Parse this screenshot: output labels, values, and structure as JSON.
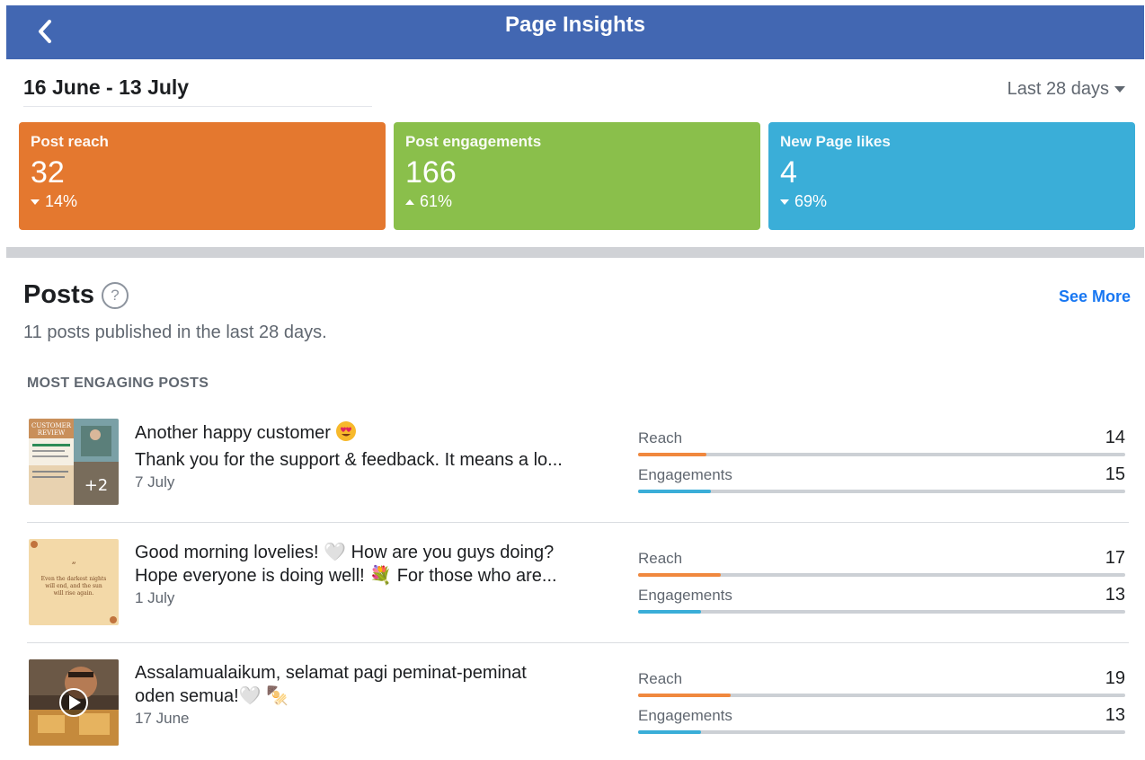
{
  "header": {
    "title": "Page Insights",
    "back_icon": "chevron-left-icon"
  },
  "range": {
    "date_range": "16 June - 13 July",
    "period": "Last 28 days"
  },
  "cards": [
    {
      "label": "Post reach",
      "value": "32",
      "change": "14%",
      "direction": "down",
      "color": "#e4782f"
    },
    {
      "label": "Post engagements",
      "value": "166",
      "change": "61%",
      "direction": "up",
      "color": "#8abf4b"
    },
    {
      "label": "New Page likes",
      "value": "4",
      "change": "69%",
      "direction": "down",
      "color": "#3aaed8"
    }
  ],
  "posts": {
    "title": "Posts",
    "see_more": "See More",
    "subtitle": "11 posts published in the last 28 days.",
    "section_title": "MOST ENGAGING POSTS",
    "items": [
      {
        "line1": "Another happy customer",
        "line2": "Thank you for the support & feedback. It means a lo...",
        "date": "7 July",
        "thumb_overlay": "+2",
        "thumb_caption": "CUSTOMER REVIEW",
        "reach_label": "Reach",
        "reach": "14",
        "reach_fraction": 0.14,
        "eng_label": "Engagements",
        "engagements": "15",
        "eng_fraction": 0.15
      },
      {
        "line1": "Good morning lovelies! 🤍 How are you guys doing?",
        "line2": "Hope everyone is doing well! 💐 For those who are...",
        "date": "1 July",
        "thumb_caption": "Even the darkest nights will end, and the sun will rise again.",
        "reach_label": "Reach",
        "reach": "17",
        "reach_fraction": 0.17,
        "eng_label": "Engagements",
        "engagements": "13",
        "eng_fraction": 0.13
      },
      {
        "line1": "Assalamualaikum, selamat pagi peminat-peminat",
        "line2": "oden semua!🤍 🍢",
        "date": "17 June",
        "reach_label": "Reach",
        "reach": "19",
        "reach_fraction": 0.19,
        "eng_label": "Engagements",
        "engagements": "13",
        "eng_fraction": 0.13
      }
    ]
  },
  "colors": {
    "header": "#4267b2",
    "reach_bar": "#f0883e",
    "eng_bar": "#3aaed8",
    "link": "#1877f2"
  }
}
